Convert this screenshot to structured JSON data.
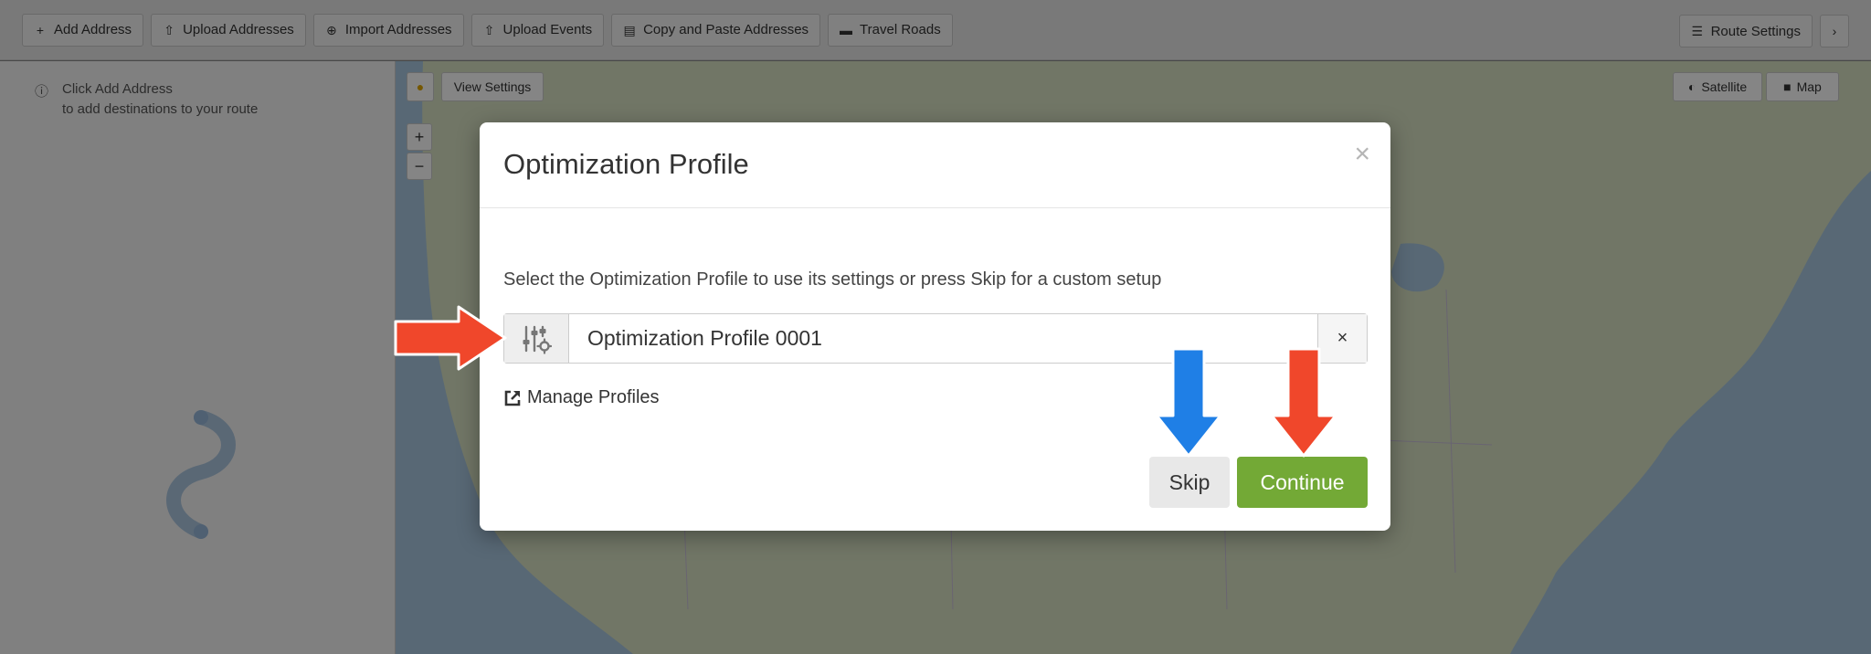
{
  "toolbar": {
    "items": [
      {
        "label": "Add Address",
        "icon": "plus-icon"
      },
      {
        "label": "Upload Addresses",
        "icon": "upload-icon"
      },
      {
        "label": "Import Addresses",
        "icon": "import-icon"
      },
      {
        "label": "Upload Events",
        "icon": "upload-icon"
      },
      {
        "label": "Copy and Paste Addresses",
        "icon": "clipboard-icon"
      },
      {
        "label": "Travel Roads",
        "icon": "truck-icon"
      }
    ],
    "route_settings_label": "Route Settings"
  },
  "sidebar": {
    "hint_line1": "Click Add Address",
    "hint_line2": "to add destinations to your route"
  },
  "map": {
    "view_settings_label": "View Settings",
    "satellite_label": "Satellite",
    "map_label": "Map"
  },
  "modal": {
    "title": "Optimization Profile",
    "close_glyph": "×",
    "description": "Select the Optimization Profile to use its settings or press Skip for a custom setup",
    "profile_value": "Optimization Profile 0001",
    "clear_glyph": "×",
    "manage_profiles_label": "Manage Profiles",
    "skip_label": "Skip",
    "continue_label": "Continue"
  },
  "colors": {
    "continue_green": "#73a936",
    "annotation_red": "#f0472b",
    "annotation_blue": "#1f7fe6"
  }
}
